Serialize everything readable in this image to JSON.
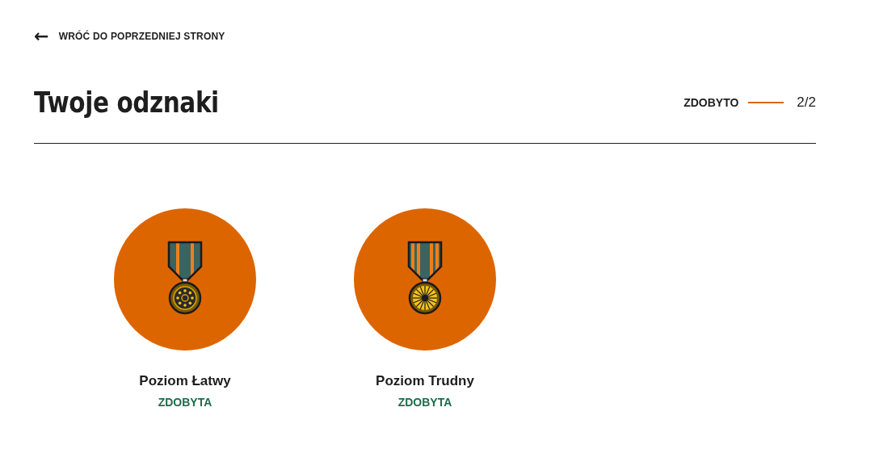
{
  "back_link": {
    "icon": "←",
    "label": "WRÓĆ DO POPRZEDNIEJ STRONY"
  },
  "title": "Twoje odznaki",
  "progress": {
    "label": "ZDOBYTO",
    "count": "2/2"
  },
  "badges": [
    {
      "name": "Poziom Łatwy",
      "status": "ZDOBYTA",
      "earned": true,
      "kind": "dots"
    },
    {
      "name": "Poziom Trudny",
      "status": "ZDOBYTA",
      "earned": true,
      "kind": "rays"
    }
  ]
}
